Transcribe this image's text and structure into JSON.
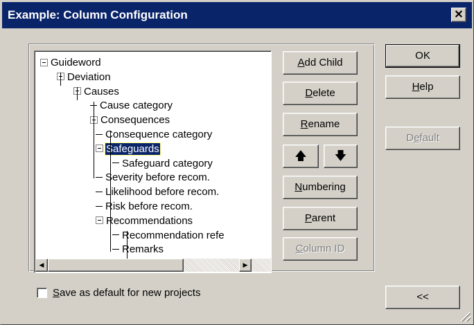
{
  "window": {
    "title": "Example: Column Configuration",
    "close_glyph": "✕"
  },
  "tree": {
    "nodes": [
      {
        "label": "Guideword",
        "expander": true,
        "level": 0
      },
      {
        "label": "Deviation",
        "expander": true,
        "level": 1
      },
      {
        "label": "Causes",
        "expander": true,
        "level": 2
      },
      {
        "label": "Cause category",
        "expander": false,
        "level": 3
      },
      {
        "label": "Consequences",
        "expander": true,
        "level": 3
      },
      {
        "label": "Consequence category",
        "expander": false,
        "level": 4
      },
      {
        "label": "Safeguards",
        "expander": true,
        "level": 4,
        "selected": true
      },
      {
        "label": "Safeguard category",
        "expander": false,
        "level": 5
      },
      {
        "label": "Severity before recom.",
        "expander": false,
        "level": 4
      },
      {
        "label": "Likelihood before recom.",
        "expander": false,
        "level": 4
      },
      {
        "label": "Risk before recom.",
        "expander": false,
        "level": 4
      },
      {
        "label": "Recommendations",
        "expander": true,
        "level": 4
      },
      {
        "label": "Recommendation refe",
        "expander": false,
        "level": 5
      },
      {
        "label": "Remarks",
        "expander": false,
        "level": 5
      }
    ]
  },
  "buttons": {
    "add_child": {
      "pre": "",
      "key": "A",
      "post": "dd Child"
    },
    "delete": {
      "pre": "",
      "key": "D",
      "post": "elete"
    },
    "rename": {
      "pre": "",
      "key": "R",
      "post": "ename"
    },
    "move_up": "🡅",
    "move_down": "🡇",
    "numbering": {
      "pre": "",
      "key": "N",
      "post": "umbering"
    },
    "parent": {
      "pre": "",
      "key": "P",
      "post": "arent"
    },
    "column_id": {
      "pre": "",
      "key": "C",
      "post": "olumn ID"
    },
    "ok": "OK",
    "help": {
      "pre": "",
      "key": "H",
      "post": "elp"
    },
    "default": {
      "pre": "D",
      "key": "e",
      "post": "fault"
    },
    "collapse": "<<"
  },
  "checkbox": {
    "pre": "",
    "key": "S",
    "post": "ave as default for new projects",
    "checked": false
  }
}
